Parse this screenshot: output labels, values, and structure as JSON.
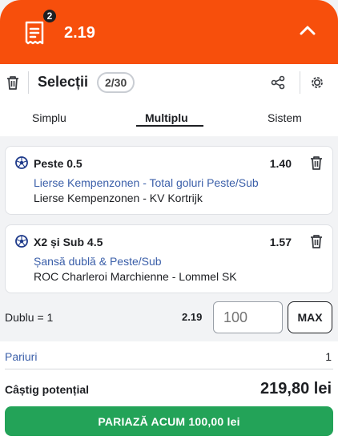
{
  "header": {
    "ticket_count": "2",
    "total_odds": "2.19"
  },
  "toolbar": {
    "title": "Selecții",
    "selection_count": "2/30"
  },
  "tabs": [
    {
      "label": "Simplu",
      "active": false
    },
    {
      "label": "Multiplu",
      "active": true
    },
    {
      "label": "Sistem",
      "active": false
    }
  ],
  "selections": [
    {
      "pick": "Peste 0.5",
      "odd": "1.40",
      "market": "Lierse Kempenzonen - Total goluri Peste/Sub",
      "match": "Lierse Kempenzonen - KV Kortrijk"
    },
    {
      "pick": "X2 și Sub 4.5",
      "odd": "1.57",
      "market": "Șansă dublă & Peste/Sub",
      "match": "ROC Charleroi Marchienne - Lommel SK"
    }
  ],
  "stake": {
    "label": "Dublu = 1",
    "odd": "2.19",
    "placeholder": "100",
    "max_label": "MAX"
  },
  "summary": {
    "bets_label": "Pariuri",
    "bets_value": "1",
    "potential_label": "Câștig potențial",
    "potential_value": "219,80 lei"
  },
  "place_bet_label": "PARIAZĂ ACUM 100,00 lei",
  "colors": {
    "accent": "#f74f0c",
    "market_link": "#3b5fa9",
    "place_button": "#23a358"
  }
}
